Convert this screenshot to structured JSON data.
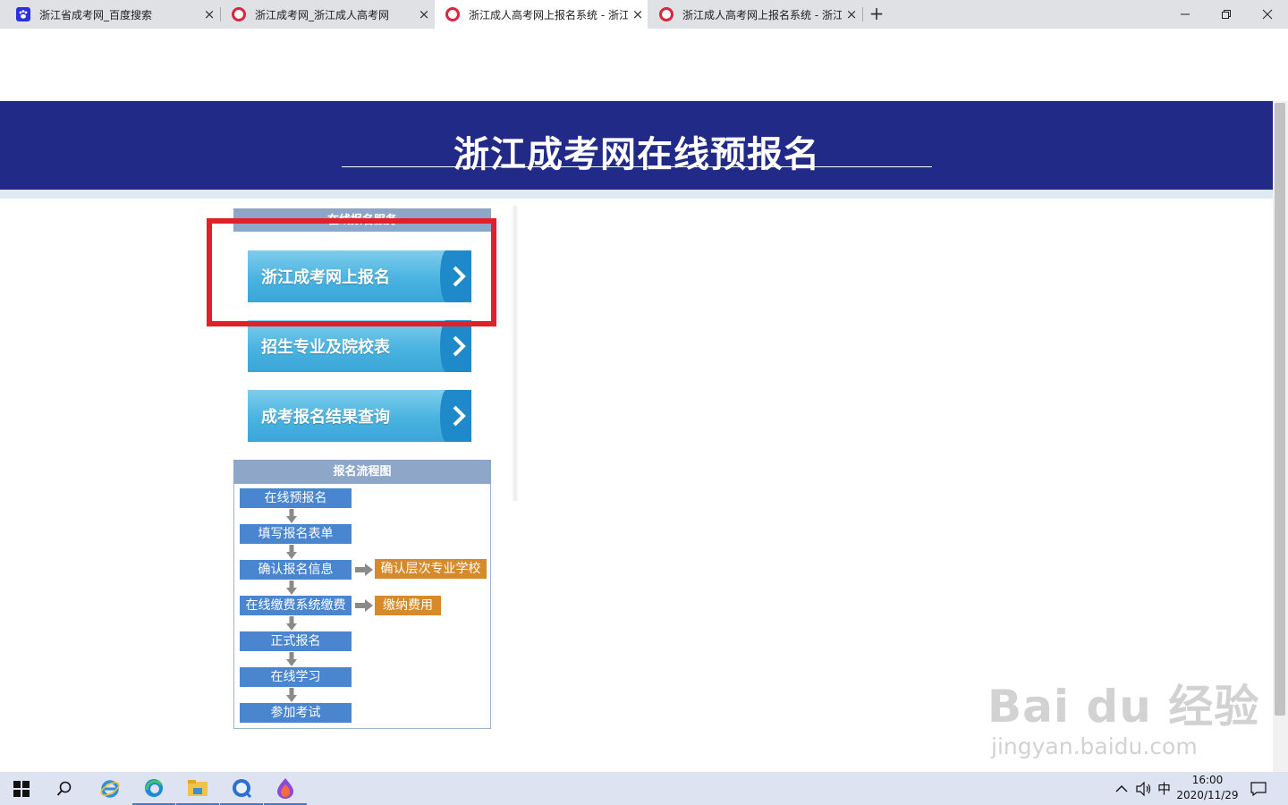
{
  "browser": {
    "tabs": [
      {
        "title": "浙江省成考网_百度搜索",
        "icon": "baidu-paw-icon"
      },
      {
        "title": "浙江成考网_浙江成人高考网",
        "icon": "shield-icon"
      },
      {
        "title": "浙江成人高考网上报名系统 - 浙江",
        "icon": "shield-icon"
      },
      {
        "title": "浙江成人高考网上报名系统 - 浙江",
        "icon": "shield-icon"
      }
    ],
    "active_tab": 2,
    "close_glyph": "×",
    "new_tab_glyph": "+"
  },
  "header": {
    "title": "浙江成考网在线预报名"
  },
  "sidebar": {
    "panel_title": "在线报名服务",
    "buttons": [
      {
        "label": "浙江成考网上报名"
      },
      {
        "label": "招生专业及院校表"
      },
      {
        "label": "成考报名结果查询"
      }
    ]
  },
  "flow": {
    "title": "报名流程图",
    "steps": [
      "在线预报名",
      "填写报名表单",
      "确认报名信息",
      "在线缴费系统缴费",
      "正式报名",
      "在线学习",
      "参加考试"
    ],
    "side_steps": [
      "确认层次专业学校",
      "缴纳费用"
    ]
  },
  "watermark": {
    "brand": "Bai du 经验",
    "url": "jingyan.baidu.com"
  },
  "taskbar": {
    "ime": "中",
    "time": "16:00",
    "date": "2020/11/29"
  },
  "colors": {
    "banner": "#212a87",
    "nav_button": "#49b3e0",
    "flow_step": "#4a86d0",
    "flow_side_step": "#d78a2a",
    "highlight": "#e0202a"
  }
}
